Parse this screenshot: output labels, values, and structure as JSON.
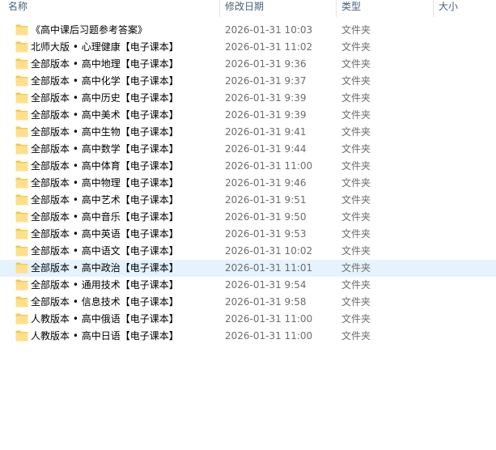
{
  "columns": {
    "name": "名称",
    "date": "修改日期",
    "type": "类型",
    "size": "大小"
  },
  "icon": "folder-icon",
  "colors": {
    "folder_light": "#FFE08A",
    "folder_dark": "#F2C94C",
    "hover_row": "#E5F3FF"
  },
  "files": [
    {
      "name": "《高中课后习题参考答案》",
      "date": "2026-01-31 10:03",
      "type": "文件夹",
      "size": ""
    },
    {
      "name": "北师大版 • 心理健康【电子课本】",
      "date": "2026-01-31 11:02",
      "type": "文件夹",
      "size": ""
    },
    {
      "name": "全部版本 • 高中地理【电子课本】",
      "date": "2026-01-31 9:36",
      "type": "文件夹",
      "size": ""
    },
    {
      "name": "全部版本 • 高中化学【电子课本】",
      "date": "2026-01-31 9:37",
      "type": "文件夹",
      "size": ""
    },
    {
      "name": "全部版本 • 高中历史【电子课本】",
      "date": "2026-01-31 9:39",
      "type": "文件夹",
      "size": ""
    },
    {
      "name": "全部版本 • 高中美术【电子课本】",
      "date": "2026-01-31 9:39",
      "type": "文件夹",
      "size": ""
    },
    {
      "name": "全部版本 • 高中生物【电子课本】",
      "date": "2026-01-31 9:41",
      "type": "文件夹",
      "size": ""
    },
    {
      "name": "全部版本 • 高中数学【电子课本】",
      "date": "2026-01-31 9:44",
      "type": "文件夹",
      "size": ""
    },
    {
      "name": "全部版本 • 高中体育【电子课本】",
      "date": "2026-01-31 11:00",
      "type": "文件夹",
      "size": ""
    },
    {
      "name": "全部版本 • 高中物理【电子课本】",
      "date": "2026-01-31 9:46",
      "type": "文件夹",
      "size": ""
    },
    {
      "name": "全部版本 • 高中艺术【电子课本】",
      "date": "2026-01-31 9:51",
      "type": "文件夹",
      "size": ""
    },
    {
      "name": "全部版本 • 高中音乐【电子课本】",
      "date": "2026-01-31 9:50",
      "type": "文件夹",
      "size": ""
    },
    {
      "name": "全部版本 • 高中英语【电子课本】",
      "date": "2026-01-31 9:53",
      "type": "文件夹",
      "size": ""
    },
    {
      "name": "全部版本 • 高中语文【电子课本】",
      "date": "2026-01-31 10:02",
      "type": "文件夹",
      "size": ""
    },
    {
      "name": "全部版本 • 高中政治【电子课本】",
      "date": "2026-01-31 11:01",
      "type": "文件夹",
      "size": "",
      "hover": true
    },
    {
      "name": "全部版本 • 通用技术【电子课本】",
      "date": "2026-01-31 9:54",
      "type": "文件夹",
      "size": ""
    },
    {
      "name": "全部版本 • 信息技术【电子课本】",
      "date": "2026-01-31 9:58",
      "type": "文件夹",
      "size": ""
    },
    {
      "name": "人教版本 • 高中俄语【电子课本】",
      "date": "2026-01-31 11:00",
      "type": "文件夹",
      "size": ""
    },
    {
      "name": "人教版本 • 高中日语【电子课本】",
      "date": "2026-01-31 11:00",
      "type": "文件夹",
      "size": ""
    }
  ]
}
